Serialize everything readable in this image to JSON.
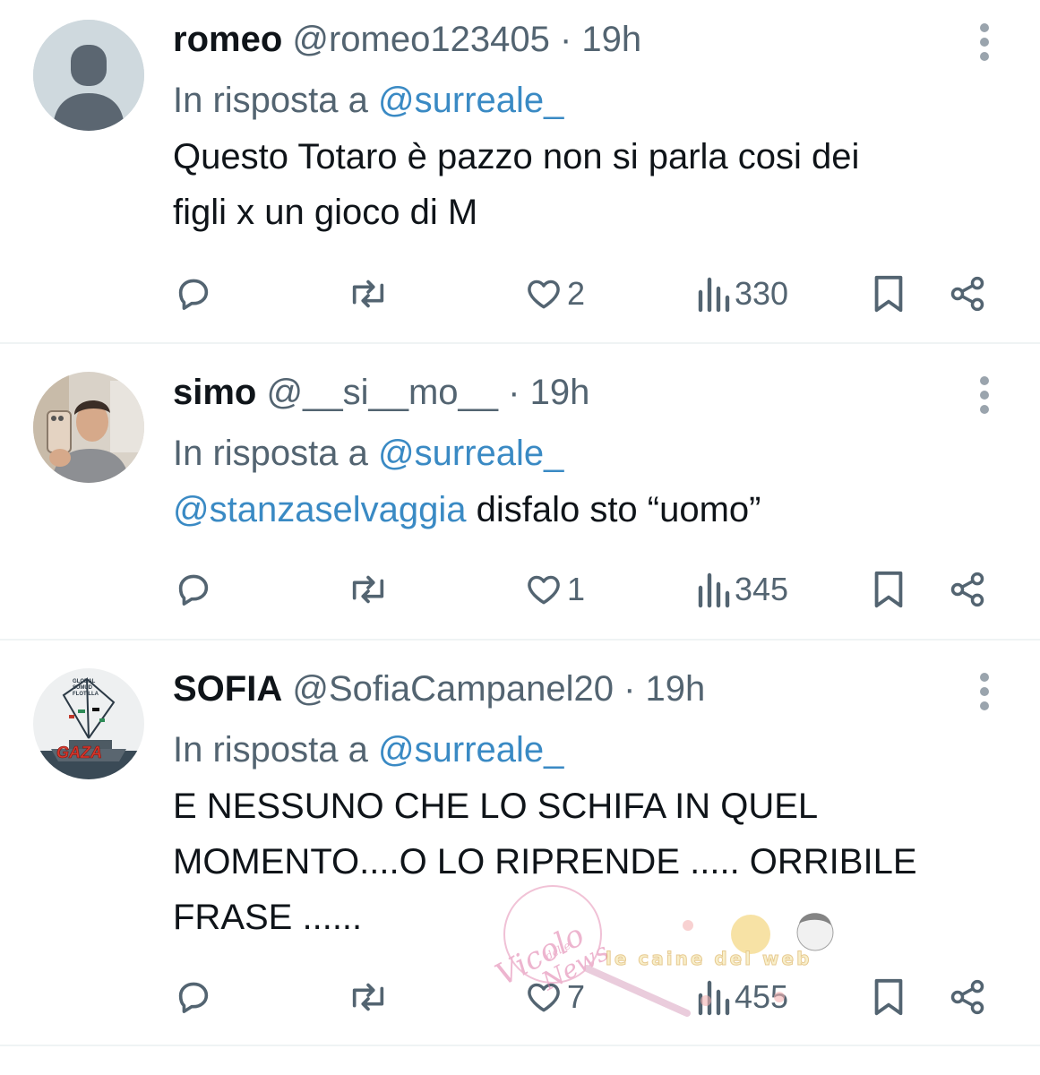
{
  "tweets": [
    {
      "display_name": "romeo",
      "handle": "@romeo123405",
      "time": "· 19h",
      "reply_prefix": "In risposta a",
      "reply_to": "@surreale_",
      "mention": "",
      "text_lines": [
        "Questo Totaro è pazzo non si parla cosi dei",
        "figli x un gioco di M"
      ],
      "likes": "2",
      "views": "330",
      "avatar": "default-avatar-icon"
    },
    {
      "display_name": "simo",
      "handle": "@__si__mo__",
      "time": "· 19h",
      "reply_prefix": "In risposta a",
      "reply_to": "@surreale_",
      "mention": "@stanzaselvaggia",
      "text_lines": [
        " disfalo sto “uomo”"
      ],
      "likes": "1",
      "views": "345",
      "avatar": "selfie-photo"
    },
    {
      "display_name": "SOFIA",
      "handle": "@SofiaCampanel20",
      "time": "· 19h",
      "reply_prefix": "In risposta a",
      "reply_to": "@surreale_",
      "mention": "",
      "text_lines": [
        "E NESSUNO CHE LO SCHIFA IN QUEL",
        "MOMENTO....O LO RIPRENDE ..... ORRIBILE",
        "FRASE ......"
      ],
      "likes": "7",
      "views": "455",
      "avatar": "global-sumud-flotilla-gaza-ship",
      "avatar_text": [
        "GLOBAL",
        "SUMUD",
        "FLOTILLA",
        "GAZA"
      ]
    }
  ],
  "watermark": {
    "left_logo": [
      "Vicolo",
      "delle",
      "News"
    ],
    "right_logo": "le caine del web"
  },
  "colors": {
    "link": "#3a8ac4",
    "muted": "#536471",
    "text": "#0f1419",
    "divider": "#eff3f4"
  }
}
